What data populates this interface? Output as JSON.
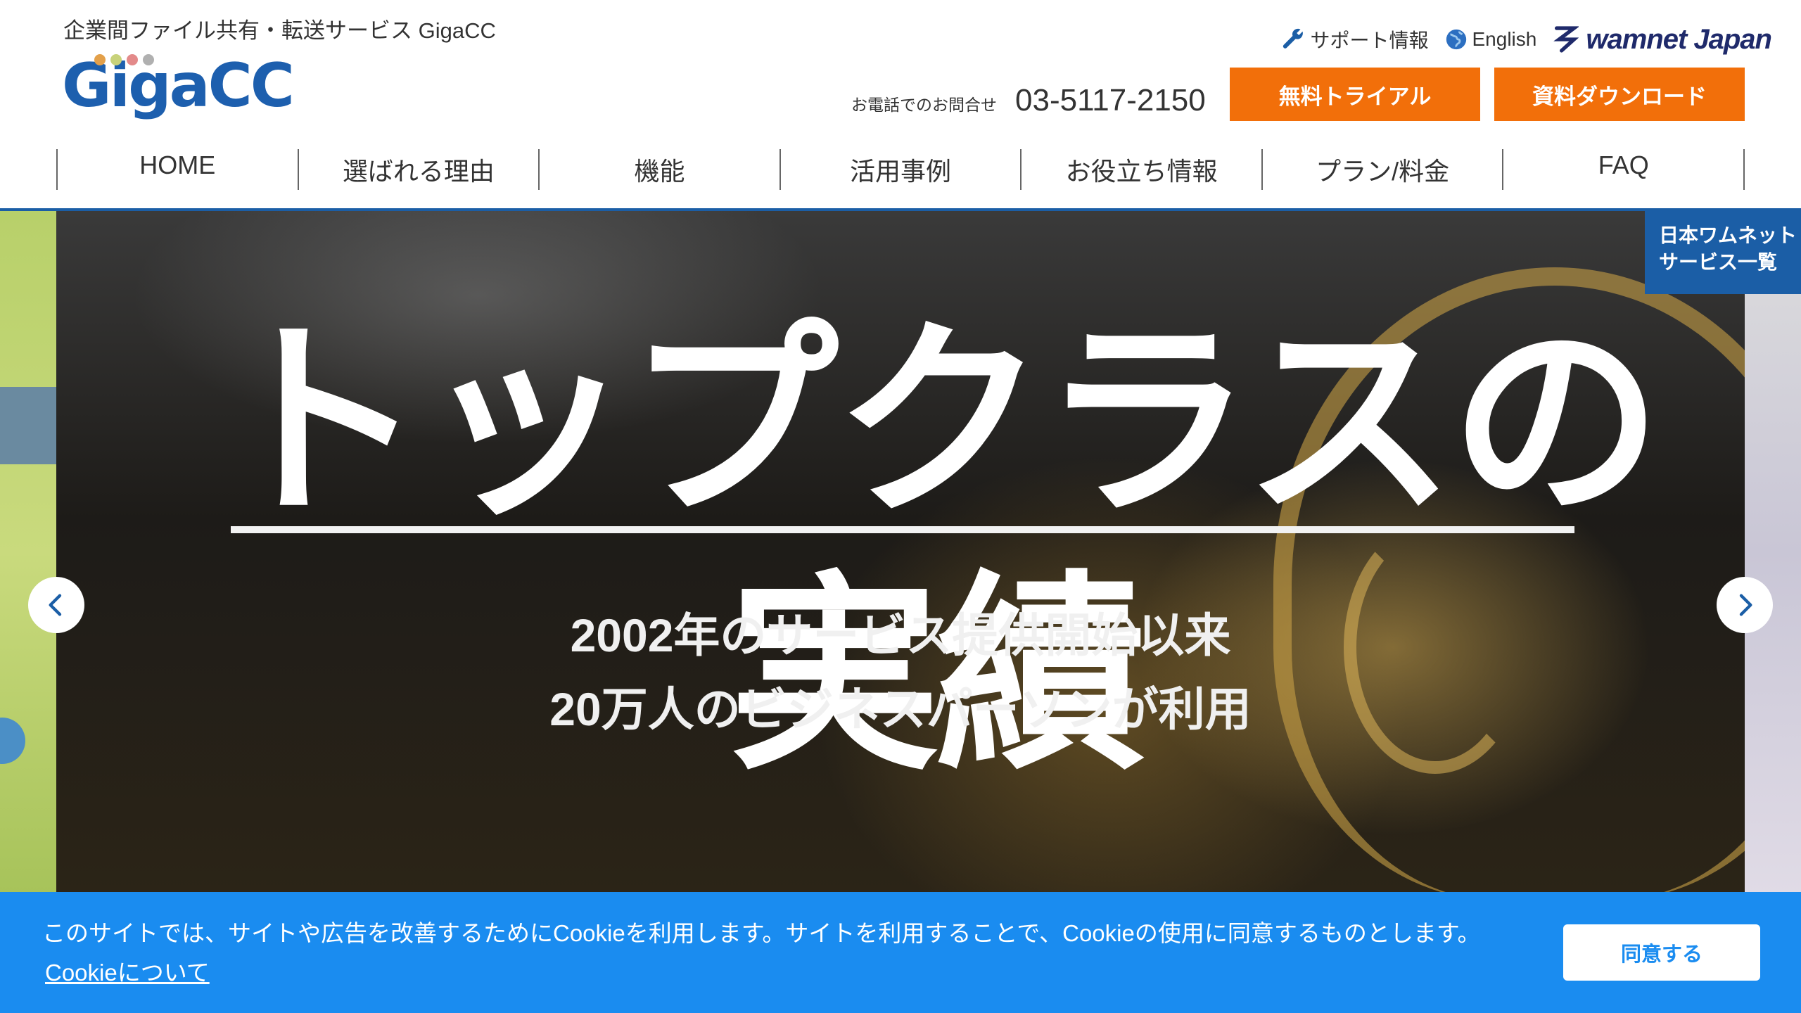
{
  "header": {
    "tagline": "企業間ファイル共有・転送サービス GigaCC",
    "logo_text": "GigaCC",
    "logo_dot_colors": [
      "#e3a04a",
      "#c8d27a",
      "#e38a8a",
      "#b0b0b0"
    ],
    "top_links": {
      "support": "サポート情報",
      "english": "English",
      "brand": "wamnet Japan"
    },
    "phone": {
      "label": "お電話でのお問合せ",
      "number": "03-5117-2150"
    },
    "cta": {
      "trial": "無料トライアル",
      "download": "資料ダウンロード"
    },
    "nav": [
      "HOME",
      "選ばれる理由",
      "機能",
      "活用事例",
      "お役立ち情報",
      "プラン/料金",
      "FAQ"
    ]
  },
  "service_tab": {
    "line1": "日本ワムネット",
    "line2": "サービス一覧"
  },
  "hero": {
    "headline": "トップクラスの実績",
    "sub1": "2002年のサービス提供開始以来",
    "sub2": "20万人のビジネスパーソンが利用"
  },
  "cookie": {
    "message": "このサイトでは、サイトや広告を改善するためにCookieを利用します。サイトを利用することで、Cookieの使用に同意するものとします。",
    "link": "Cookieについて",
    "accept": "同意する"
  },
  "colors": {
    "brand_blue": "#1b5ea6",
    "cta_orange": "#f26f0a",
    "cookie_blue": "#1a8cf0"
  },
  "icons": {
    "support": "wrench-icon",
    "english": "globe-icon",
    "brand": "wamnet-logo-icon",
    "prev": "chevron-left-icon",
    "next": "chevron-right-icon"
  }
}
